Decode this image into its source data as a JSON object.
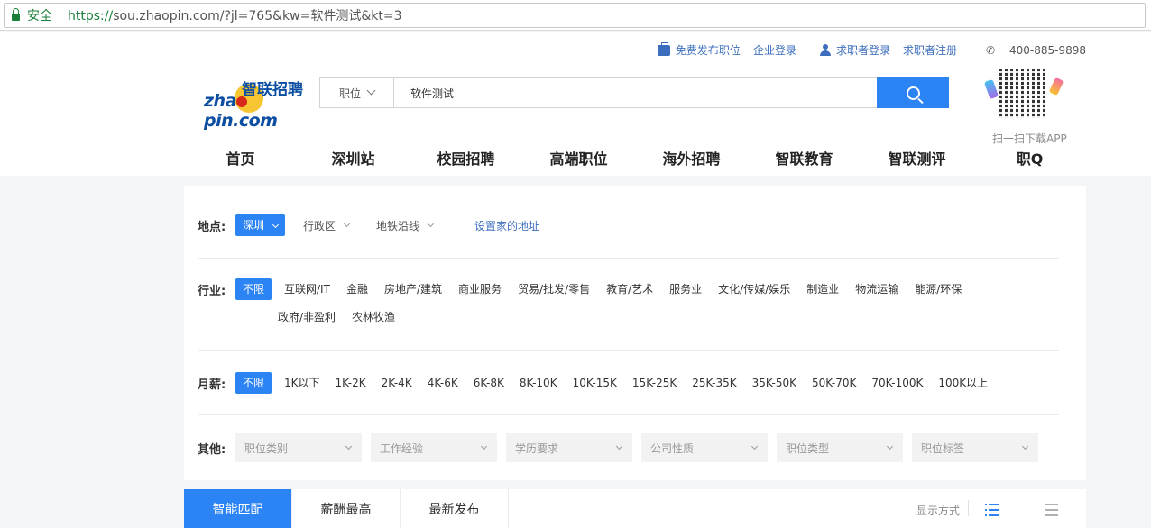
{
  "browser": {
    "secure_label": "安全",
    "url_scheme": "https://",
    "url_rest": "sou.zhaopin.com/?jl=765&kw=软件测试&kt=3"
  },
  "topbar": {
    "post_job": "免费发布职位",
    "employer_login": "企业登录",
    "seeker_login": "求职者登录",
    "seeker_register": "求职者注册",
    "phone": "400-885-9898",
    "icons": [
      "briefcase-icon",
      "user-icon",
      "phone-icon"
    ]
  },
  "logo": {
    "cn": "智联招聘",
    "en_a": "zha",
    "en_b": "pin.com"
  },
  "search": {
    "category": "职位",
    "query": "软件测试"
  },
  "app": {
    "download_label": "扫一扫下载APP"
  },
  "nav": [
    "首页",
    "深圳站",
    "校园招聘",
    "高端职位",
    "海外招聘",
    "智联教育",
    "智联测评",
    "职Q"
  ],
  "filters": {
    "location": {
      "label": "地点:",
      "city": "深圳",
      "district": "行政区",
      "subway": "地铁沿线",
      "set_home": "设置家的地址"
    },
    "industry": {
      "label": "行业:",
      "selected": "不限",
      "options_row1": [
        "互联网/IT",
        "金融",
        "房地产/建筑",
        "商业服务",
        "贸易/批发/零售",
        "教育/艺术",
        "服务业",
        "文化/传媒/娱乐",
        "制造业",
        "物流运输",
        "能源/环保"
      ],
      "options_row2": [
        "政府/非盈利",
        "农林牧渔"
      ]
    },
    "salary": {
      "label": "月薪:",
      "selected": "不限",
      "options": [
        "1K以下",
        "1K-2K",
        "2K-4K",
        "4K-6K",
        "6K-8K",
        "8K-10K",
        "10K-15K",
        "15K-25K",
        "25K-35K",
        "35K-50K",
        "50K-70K",
        "70K-100K",
        "100K以上"
      ]
    },
    "other": {
      "label": "其他:",
      "selects": [
        "职位类别",
        "工作经验",
        "学历要求",
        "公司性质",
        "职位类型",
        "职位标签"
      ]
    }
  },
  "sort_tabs": [
    "智能匹配",
    "薪酬最高",
    "最新发布"
  ],
  "display_mode_label": "显示方式",
  "colors": {
    "accent": "#2c83f3",
    "link": "#3c6ebd",
    "secure": "#188038"
  }
}
